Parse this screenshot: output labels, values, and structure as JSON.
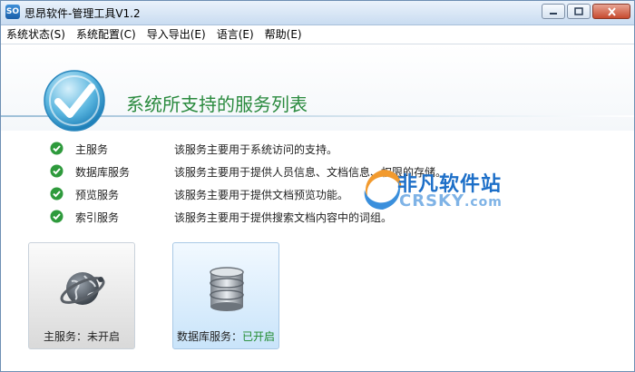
{
  "window": {
    "title": "思昂软件-管理工具V1.2",
    "icon_text": "SO"
  },
  "menu": [
    {
      "label": "系统状态(S)"
    },
    {
      "label": "系统配置(C)"
    },
    {
      "label": "导入导出(E)"
    },
    {
      "label": "语言(E)"
    },
    {
      "label": "帮助(E)"
    }
  ],
  "banner": {
    "title": "系统所支持的服务列表"
  },
  "services": [
    {
      "name": "主服务",
      "desc": "该服务主要用于系统访问的支持。"
    },
    {
      "name": "数据库服务",
      "desc": "该服务主要用于提供人员信息、文档信息、权限的存储。"
    },
    {
      "name": "预览服务",
      "desc": "该服务主要用于提供文档预览功能。"
    },
    {
      "name": "索引服务",
      "desc": "该服务主要用于提供搜索文档内容中的词组。"
    }
  ],
  "tiles": [
    {
      "label": "主服务：",
      "status": "未开启"
    },
    {
      "label": "数据库服务：",
      "status": "已开启"
    }
  ],
  "watermark": {
    "cn": "非凡软件站",
    "en": "CRSKY",
    "domain": ".com"
  },
  "colors": {
    "accent": "#2a8a3e",
    "status_on": "#1f8a2e",
    "title_bar": "#c9dcf1"
  }
}
